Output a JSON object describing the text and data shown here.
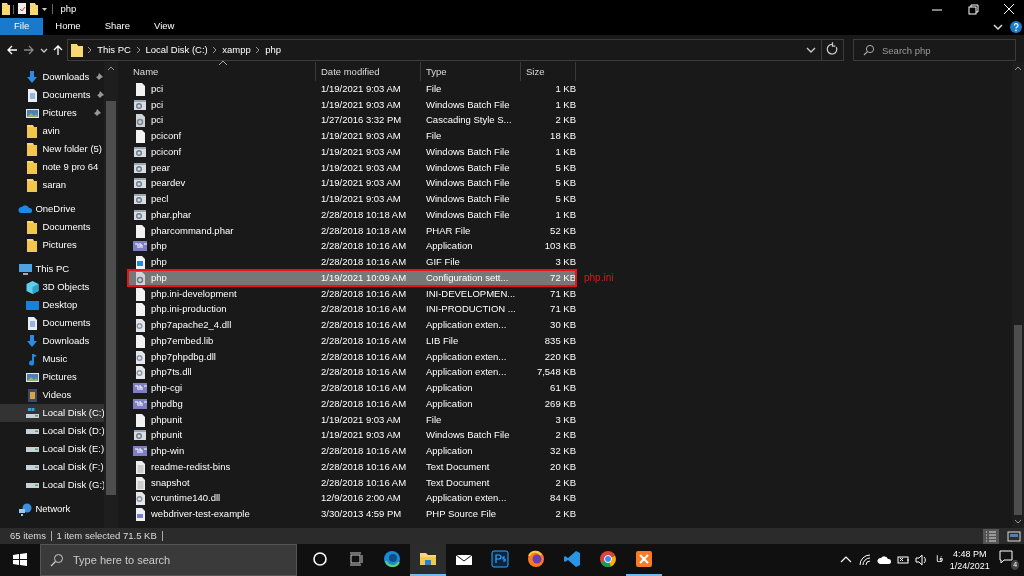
{
  "window": {
    "title": "php"
  },
  "ribbon_tabs": [
    {
      "label": "File",
      "selected": true
    },
    {
      "label": "Home",
      "selected": false
    },
    {
      "label": "Share",
      "selected": false
    },
    {
      "label": "View",
      "selected": false
    }
  ],
  "address": {
    "crumbs": [
      "This PC",
      "Local Disk (C:)",
      "xampp",
      "php"
    ]
  },
  "search": {
    "placeholder": "Search php"
  },
  "quick_access": [
    {
      "label": "Downloads",
      "kind": "download",
      "pinned": true,
      "selected": false
    },
    {
      "label": "Documents",
      "kind": "document",
      "pinned": true,
      "selected": false
    },
    {
      "label": "Pictures",
      "kind": "picture",
      "pinned": true,
      "selected": false
    },
    {
      "label": "avin",
      "kind": "folder",
      "pinned": false,
      "selected": false
    },
    {
      "label": "New folder (5)",
      "kind": "folder",
      "pinned": false,
      "selected": false
    },
    {
      "label": "note 9 pro 64",
      "kind": "folder",
      "pinned": false,
      "selected": false
    },
    {
      "label": "saran",
      "kind": "folder",
      "pinned": false,
      "selected": false
    }
  ],
  "tree": [
    {
      "label": "OneDrive",
      "kind": "cloud",
      "selected": false,
      "children": [
        {
          "label": "Documents",
          "kind": "folder",
          "selected": false
        },
        {
          "label": "Pictures",
          "kind": "folder",
          "selected": false
        }
      ]
    },
    {
      "label": "This PC",
      "kind": "pc",
      "selected": false,
      "children": [
        {
          "label": "3D Objects",
          "kind": "cube",
          "selected": false
        },
        {
          "label": "Desktop",
          "kind": "desktop",
          "selected": false
        },
        {
          "label": "Documents",
          "kind": "document",
          "selected": false
        },
        {
          "label": "Downloads",
          "kind": "download",
          "selected": false
        },
        {
          "label": "Music",
          "kind": "music",
          "selected": false
        },
        {
          "label": "Pictures",
          "kind": "picture",
          "selected": false
        },
        {
          "label": "Videos",
          "kind": "video",
          "selected": false
        },
        {
          "label": "Local Disk (C:)",
          "kind": "windrive",
          "selected": true
        },
        {
          "label": "Local Disk (D:)",
          "kind": "drive",
          "selected": false
        },
        {
          "label": "Local Disk (E:)",
          "kind": "drive",
          "selected": false
        },
        {
          "label": "Local Disk (F:)",
          "kind": "drive",
          "selected": false
        },
        {
          "label": "Local Disk (G:)",
          "kind": "drive",
          "selected": false
        }
      ]
    },
    {
      "label": "Network",
      "kind": "network",
      "selected": false
    }
  ],
  "table": {
    "columns": [
      "Name",
      "Date modified",
      "Type",
      "Size"
    ],
    "rows": [
      {
        "kind": "file",
        "name": "pci",
        "date": "1/19/2021 9:03 AM",
        "type": "File",
        "size": "1 KB",
        "selected": false
      },
      {
        "kind": "batch",
        "name": "pci",
        "date": "1/19/2021 9:03 AM",
        "type": "Windows Batch File",
        "size": "1 KB",
        "selected": false
      },
      {
        "kind": "css",
        "name": "pci",
        "date": "1/27/2016 3:32 PM",
        "type": "Cascading Style S...",
        "size": "2 KB",
        "selected": false
      },
      {
        "kind": "file",
        "name": "pciconf",
        "date": "1/19/2021 9:03 AM",
        "type": "File",
        "size": "18 KB",
        "selected": false
      },
      {
        "kind": "batch",
        "name": "pciconf",
        "date": "1/19/2021 9:03 AM",
        "type": "Windows Batch File",
        "size": "1 KB",
        "selected": false
      },
      {
        "kind": "batch",
        "name": "pear",
        "date": "1/19/2021 9:03 AM",
        "type": "Windows Batch File",
        "size": "5 KB",
        "selected": false
      },
      {
        "kind": "batch",
        "name": "peardev",
        "date": "1/19/2021 9:03 AM",
        "type": "Windows Batch File",
        "size": "5 KB",
        "selected": false
      },
      {
        "kind": "batch",
        "name": "pecl",
        "date": "1/19/2021 9:03 AM",
        "type": "Windows Batch File",
        "size": "5 KB",
        "selected": false
      },
      {
        "kind": "batch",
        "name": "phar.phar",
        "date": "2/28/2018 10:18 AM",
        "type": "Windows Batch File",
        "size": "1 KB",
        "selected": false
      },
      {
        "kind": "file",
        "name": "pharcommand.phar",
        "date": "2/28/2018 10:18 AM",
        "type": "PHAR File",
        "size": "52 KB",
        "selected": false
      },
      {
        "kind": "app",
        "name": "php",
        "date": "2/28/2018 10:16 AM",
        "type": "Application",
        "size": "103 KB",
        "selected": false
      },
      {
        "kind": "gif",
        "name": "php",
        "date": "2/28/2018 10:16 AM",
        "type": "GIF File",
        "size": "3 KB",
        "selected": false
      },
      {
        "kind": "config",
        "name": "php",
        "date": "1/19/2021 10:09 AM",
        "type": "Configuration sett...",
        "size": "72 KB",
        "selected": true,
        "outlined": true,
        "annotation": "php.ini"
      },
      {
        "kind": "file",
        "name": "php.ini-development",
        "date": "2/28/2018 10:16 AM",
        "type": "INI-DEVELOPMEN...",
        "size": "71 KB",
        "selected": false
      },
      {
        "kind": "file",
        "name": "php.ini-production",
        "date": "2/28/2018 10:16 AM",
        "type": "INI-PRODUCTION ...",
        "size": "71 KB",
        "selected": false
      },
      {
        "kind": "dll",
        "name": "php7apache2_4.dll",
        "date": "2/28/2018 10:16 AM",
        "type": "Application exten...",
        "size": "30 KB",
        "selected": false
      },
      {
        "kind": "file",
        "name": "php7embed.lib",
        "date": "2/28/2018 10:16 AM",
        "type": "LIB File",
        "size": "835 KB",
        "selected": false
      },
      {
        "kind": "dll",
        "name": "php7phpdbg.dll",
        "date": "2/28/2018 10:16 AM",
        "type": "Application exten...",
        "size": "220 KB",
        "selected": false
      },
      {
        "kind": "dll",
        "name": "php7ts.dll",
        "date": "2/28/2018 10:16 AM",
        "type": "Application exten...",
        "size": "7,548 KB",
        "selected": false
      },
      {
        "kind": "app",
        "name": "php-cgi",
        "date": "2/28/2018 10:16 AM",
        "type": "Application",
        "size": "61 KB",
        "selected": false
      },
      {
        "kind": "app",
        "name": "phpdbg",
        "date": "2/28/2018 10:16 AM",
        "type": "Application",
        "size": "269 KB",
        "selected": false
      },
      {
        "kind": "file",
        "name": "phpunit",
        "date": "1/19/2021 9:03 AM",
        "type": "File",
        "size": "3 KB",
        "selected": false
      },
      {
        "kind": "batch",
        "name": "phpunit",
        "date": "1/19/2021 9:03 AM",
        "type": "Windows Batch File",
        "size": "2 KB",
        "selected": false
      },
      {
        "kind": "app",
        "name": "php-win",
        "date": "2/28/2018 10:16 AM",
        "type": "Application",
        "size": "32 KB",
        "selected": false
      },
      {
        "kind": "text",
        "name": "readme-redist-bins",
        "date": "2/28/2018 10:16 AM",
        "type": "Text Document",
        "size": "20 KB",
        "selected": false
      },
      {
        "kind": "text",
        "name": "snapshot",
        "date": "2/28/2018 10:16 AM",
        "type": "Text Document",
        "size": "2 KB",
        "selected": false
      },
      {
        "kind": "dll",
        "name": "vcruntime140.dll",
        "date": "12/9/2016 2:00 AM",
        "type": "Application exten...",
        "size": "84 KB",
        "selected": false
      },
      {
        "kind": "source",
        "name": "webdriver-test-example",
        "date": "3/30/2013 4:59 PM",
        "type": "PHP Source File",
        "size": "2 KB",
        "selected": false
      }
    ]
  },
  "status_bar": {
    "items": [
      "65 items",
      "1 item selected  71.5 KB"
    ],
    "views": [
      {
        "kind": "details",
        "selected": true
      },
      {
        "kind": "tiles",
        "selected": false
      }
    ]
  },
  "taskbar": {
    "search_placeholder": "Type here to search",
    "apps": [
      {
        "kind": "cortana",
        "active": false,
        "running": false
      },
      {
        "kind": "taskview",
        "active": false,
        "running": false
      },
      {
        "kind": "edge",
        "active": false,
        "running": false
      },
      {
        "kind": "explorer",
        "active": true,
        "running": true
      },
      {
        "kind": "mail",
        "active": false,
        "running": false
      },
      {
        "kind": "photoshop",
        "active": false,
        "running": false
      },
      {
        "kind": "firefox",
        "active": false,
        "running": false
      },
      {
        "kind": "vscode",
        "active": false,
        "running": false
      },
      {
        "kind": "chrome",
        "active": false,
        "running": false
      },
      {
        "kind": "xampp",
        "active": false,
        "running": true
      }
    ],
    "language": "فا",
    "time": "4:48 PM",
    "date": "1/24/2021",
    "notifications": "4"
  }
}
